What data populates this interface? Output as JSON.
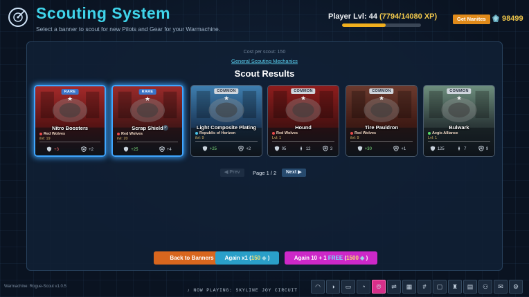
{
  "header": {
    "title": "Scouting System",
    "subtitle": "Select a banner to scout for new Pilots and Gear for your Warmachine.",
    "player_level_label": "Player Lvl: 44",
    "xp_text": "(7794/14080 XP)",
    "xp_progress": 0.5536,
    "get_nanites_label": "Get Nanites",
    "nanite_count": "98499"
  },
  "panel": {
    "cost_text": "Cost per scout: 150",
    "mechanics_link": "General Scouting Mechanics",
    "results_title": "Scout Results"
  },
  "cards": [
    {
      "name": "Nitro Boosters",
      "rarity": "RARE",
      "faction": "Red Wolves",
      "ilvl": "ilvl: 19",
      "selected": true,
      "stats": [
        {
          "icon": "shield-heart-icon",
          "value": "+3",
          "tone": "neg"
        },
        {
          "icon": "armor-icon",
          "value": "+2",
          "tone": "neutral"
        }
      ],
      "palette": {
        "bg": "#5a1414",
        "accent": "#a42a2a"
      }
    },
    {
      "name": "Scrap Shield",
      "rarity": "RARE",
      "faction": "Red Wolves",
      "ilvl": "ilvl: 20",
      "selected": true,
      "badge": "P",
      "stats": [
        {
          "icon": "shield-heart-icon",
          "value": "+25",
          "tone": "pos"
        },
        {
          "icon": "armor-icon",
          "value": "+4",
          "tone": "neutral"
        }
      ],
      "palette": {
        "bg": "#4a1717",
        "accent": "#9a2a2a"
      }
    },
    {
      "name": "Light Composite Plating",
      "rarity": "COMMON",
      "faction": "Republic of Horizon",
      "ilvl": "ilvl: 9",
      "selected": false,
      "stats": [
        {
          "icon": "shield-heart-icon",
          "value": "+25",
          "tone": "pos"
        },
        {
          "icon": "armor-icon",
          "value": "+2",
          "tone": "neutral"
        }
      ],
      "palette": {
        "bg": "#1d3b5c",
        "accent": "#3f7fb0"
      }
    },
    {
      "name": "Hound",
      "rarity": "COMMON",
      "faction": "Red Wolves",
      "ilvl": "Lvl: 1",
      "selected": false,
      "stats": [
        {
          "icon": "shield-heart-icon",
          "value": "05",
          "tone": "neutral"
        },
        {
          "icon": "attack-icon",
          "value": "12",
          "tone": "neutral"
        },
        {
          "icon": "armor-icon",
          "value": "3",
          "tone": "neutral"
        }
      ],
      "palette": {
        "bg": "#4a1111",
        "accent": "#8f1d1d"
      }
    },
    {
      "name": "Tire Pauldron",
      "rarity": "COMMON",
      "faction": "Red Wolves",
      "ilvl": "ilvl: 9",
      "selected": false,
      "stats": [
        {
          "icon": "shield-heart-icon",
          "value": "+30",
          "tone": "pos"
        },
        {
          "icon": "armor-icon",
          "value": "+1",
          "tone": "neutral"
        }
      ],
      "palette": {
        "bg": "#3f1a14",
        "accent": "#6b3a2e"
      }
    },
    {
      "name": "Bulwark",
      "rarity": "COMMON",
      "faction": "Aegis Alliance",
      "ilvl": "Lvl: 1",
      "selected": false,
      "stats": [
        {
          "icon": "shield-heart-icon",
          "value": "125",
          "tone": "neutral"
        },
        {
          "icon": "attack-icon",
          "value": "7",
          "tone": "neutral"
        },
        {
          "icon": "armor-icon",
          "value": "9",
          "tone": "neutral"
        }
      ],
      "palette": {
        "bg": "#2d3a3a",
        "accent": "#6e8f7e"
      }
    }
  ],
  "pager": {
    "prev_label": "Prev",
    "page_indicator": "Page 1 / 2",
    "next_label": "Next"
  },
  "actions": {
    "back_label": "Back to Banners",
    "again1_prefix": "Again x1 (",
    "again1_cost": "150",
    "again1_suffix": ")",
    "again10_prefix": "Again 10 + 1 ",
    "again10_free": "FREE",
    "again10_cost": "1500",
    "again10_open": " (",
    "again10_suffix": ")"
  },
  "footer": {
    "version": "Warmachine: Rogue-Scout v1.0.5",
    "now_playing": "♪ NOW PLAYING: SKYLINE JOY CIRCUIT"
  },
  "toolbar_icons": [
    "helmet-icon",
    "mech-icon",
    "chat-icon",
    "robot-icon",
    "scouting-icon",
    "swords-icon",
    "calendar-icon",
    "hashtag-icon",
    "frame-icon",
    "trophy-icon",
    "gallery-icon",
    "users-icon",
    "mail-icon",
    "settings-icon"
  ],
  "toolbar_active": 4
}
